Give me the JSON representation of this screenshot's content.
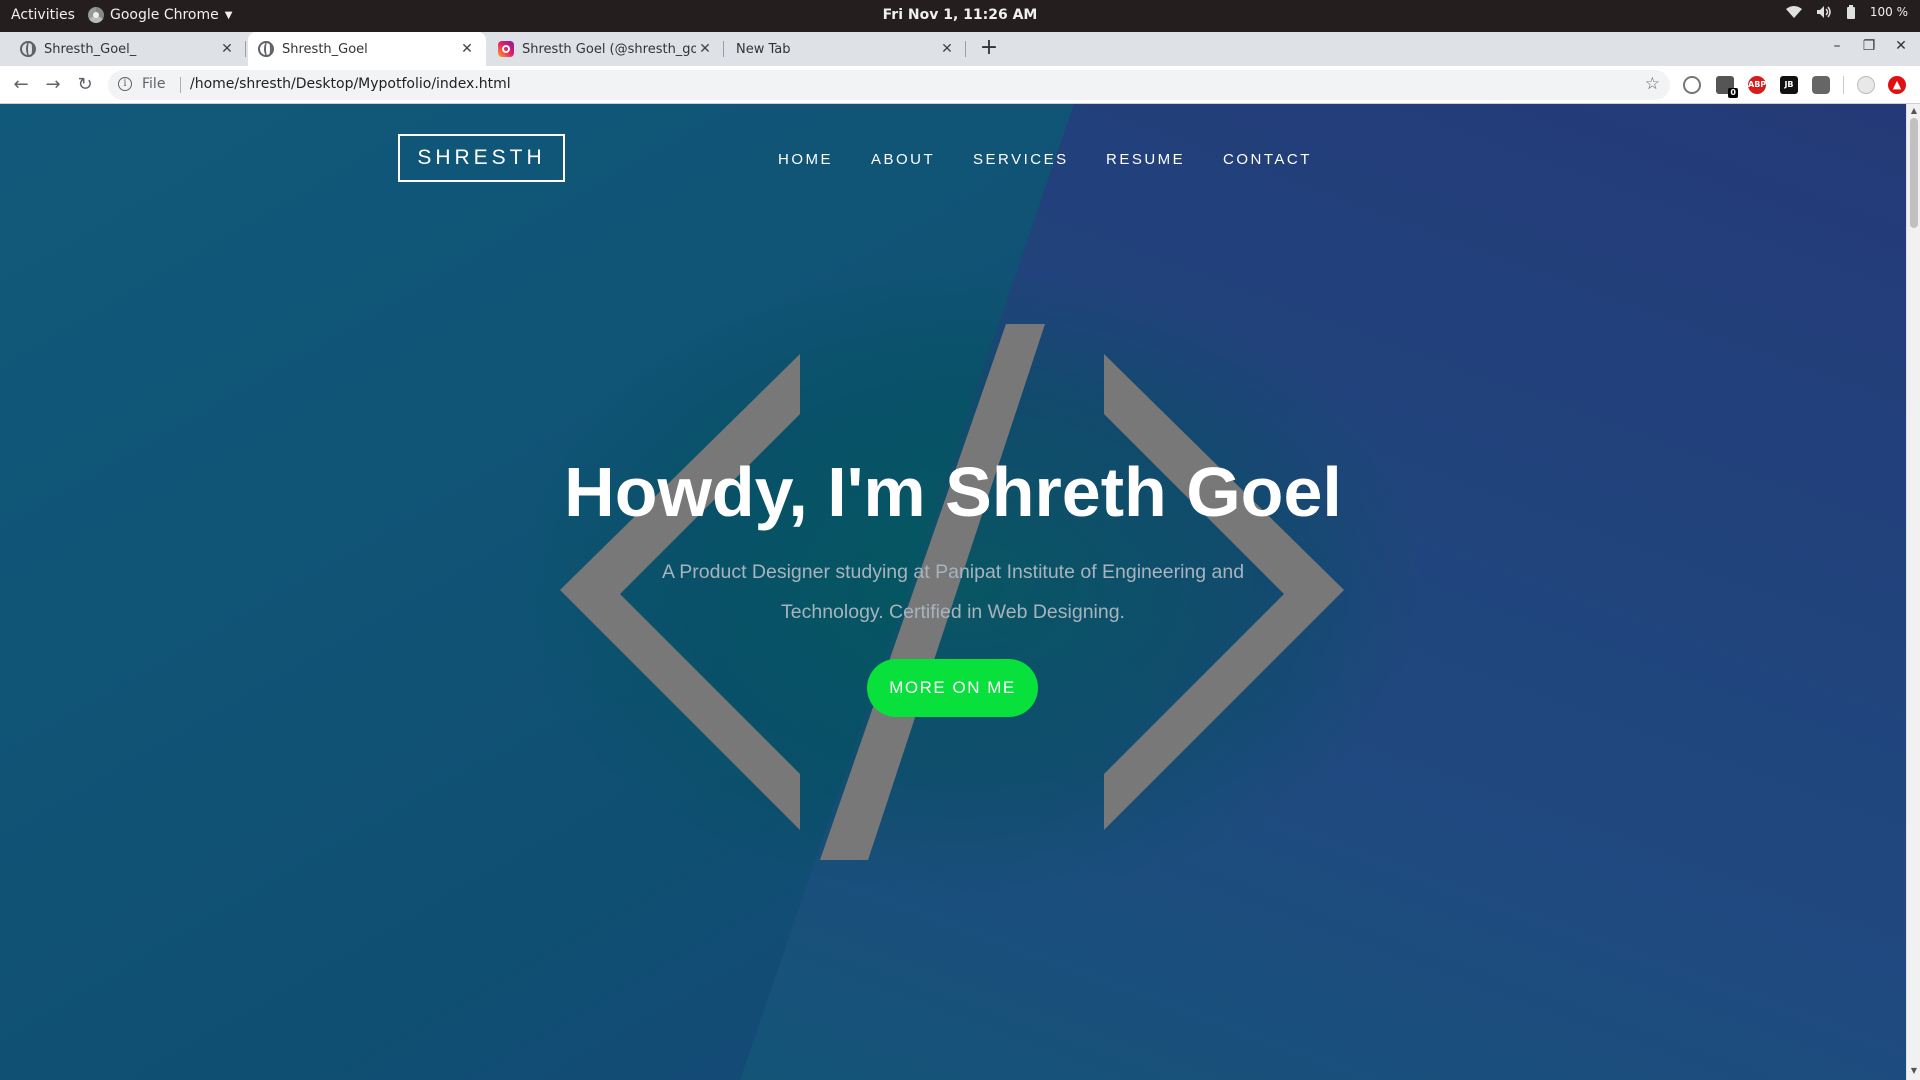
{
  "system_bar": {
    "activities": "Activities",
    "app_name": "Google Chrome",
    "clock": "Fri Nov  1, 11:26 AM",
    "battery": "100 %"
  },
  "tabs": [
    {
      "title": "Shresth_Goel_",
      "favicon": "globe-icon",
      "active": false
    },
    {
      "title": "Shresth_Goel",
      "favicon": "globe-icon",
      "active": true
    },
    {
      "title": "Shresth Goel (@shresth_goel",
      "favicon": "instagram-icon",
      "active": false
    },
    {
      "title": "New Tab",
      "favicon": "none",
      "active": false
    }
  ],
  "toolbar": {
    "scheme_label": "File",
    "url": "/home/shresth/Desktop/Mypotfolio/index.html",
    "extensions": [
      "globe-extension-icon",
      "counter-extension-icon",
      "adblock-plus-icon",
      "jetbrains-icon",
      "media-extension-icon",
      "profile-avatar-icon",
      "update-alert-icon"
    ],
    "extension_badge": "0",
    "adblock_label": "ABP",
    "jetbrains_label": "JB"
  },
  "page": {
    "logo": "SHRESTH",
    "nav": [
      "HOME",
      "ABOUT",
      "SERVICES",
      "RESUME",
      "CONTACT"
    ],
    "hero": {
      "greeting": "Howdy, I'm ",
      "name": "Shreth Goel",
      "subtitle": "A Product Designer studying at Panipat Institute of Engineering and Technology. Certified in Web Designing.",
      "cta": "MORE ON ME"
    },
    "colors": {
      "background_left": "#11597a",
      "background_right": "#243a78",
      "code_symbol": "#787878",
      "cta": "#08e03c"
    },
    "background_icon": "code-brackets-icon"
  }
}
